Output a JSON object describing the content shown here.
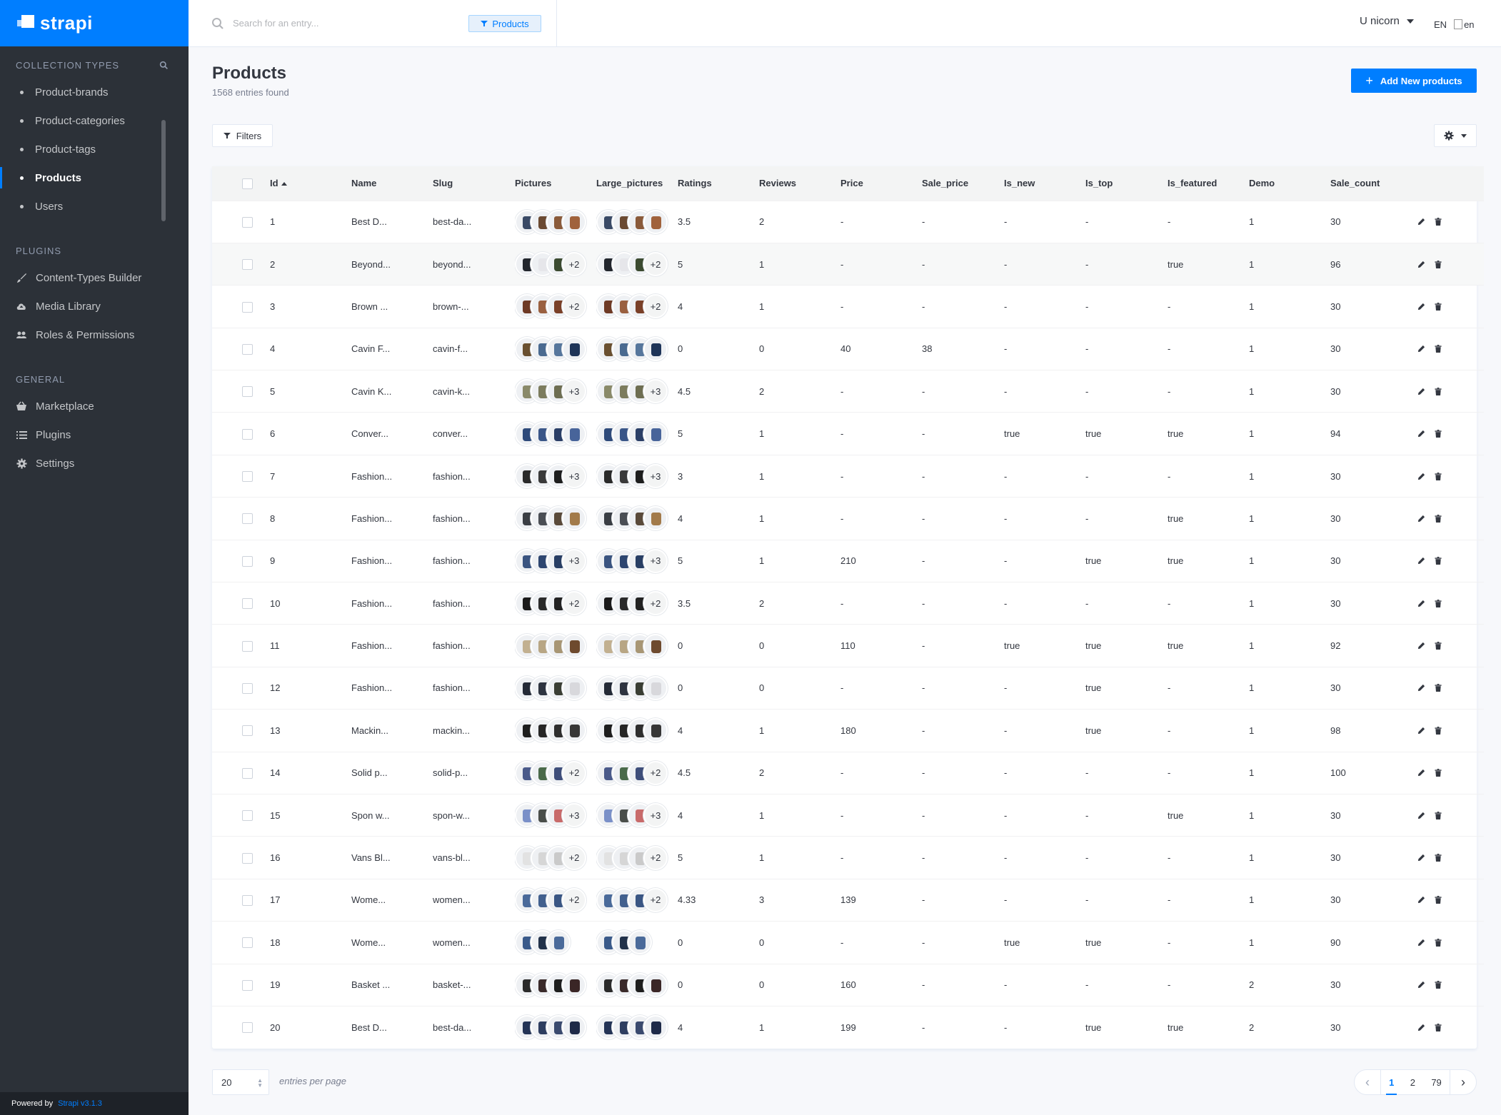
{
  "brand": {
    "name": "strapi"
  },
  "sidebar": {
    "collection_title": "COLLECTION TYPES",
    "collection_items": [
      {
        "label": "Product-brands"
      },
      {
        "label": "Product-categories"
      },
      {
        "label": "Product-tags"
      },
      {
        "label": "Products",
        "active": true
      },
      {
        "label": "Users"
      }
    ],
    "plugins_title": "PLUGINS",
    "plugin_items": [
      {
        "label": "Content-Types Builder",
        "icon": "paint-brush-icon"
      },
      {
        "label": "Media Library",
        "icon": "cloud-upload-icon"
      },
      {
        "label": "Roles & Permissions",
        "icon": "users-icon"
      }
    ],
    "general_title": "GENERAL",
    "general_items": [
      {
        "label": "Marketplace",
        "icon": "shopping-basket-icon"
      },
      {
        "label": "Plugins",
        "icon": "list-icon"
      },
      {
        "label": "Settings",
        "icon": "gear-icon"
      }
    ],
    "powered_by": "Powered by",
    "powered_link": "Strapi v3.1.3"
  },
  "header": {
    "search_placeholder": "Search for an entry...",
    "search_tag": "Products",
    "user": "U nicorn",
    "lang": "EN",
    "flag_alt": "en"
  },
  "page": {
    "title": "Products",
    "subtitle": "1568 entries found",
    "add_button": "Add New products",
    "filters_button": "Filters"
  },
  "table": {
    "columns": [
      "Id",
      "Name",
      "Slug",
      "Pictures",
      "Large_pictures",
      "Ratings",
      "Reviews",
      "Price",
      "Sale_price",
      "Is_new",
      "Is_top",
      "Is_featured",
      "Demo",
      "Sale_count"
    ],
    "rows": [
      {
        "id": "1",
        "name": "Best D...",
        "slug": "best-da...",
        "pics": [
          "#3a4a66",
          "#6b4a32",
          "#8a5a3a",
          "#a0623c"
        ],
        "more": "",
        "ratings": "3.5",
        "reviews": "2",
        "price": "-",
        "sale_price": "-",
        "is_new": "-",
        "is_top": "-",
        "is_featured": "-",
        "demo": "1",
        "sale_count": "30"
      },
      {
        "id": "2",
        "name": "Beyond...",
        "slug": "beyond...",
        "pics": [
          "#22262d",
          "#e6e6ea",
          "#3b4a30"
        ],
        "more": "+2",
        "ratings": "5",
        "reviews": "1",
        "price": "-",
        "sale_price": "-",
        "is_new": "-",
        "is_top": "-",
        "is_featured": "true",
        "demo": "1",
        "sale_count": "96"
      },
      {
        "id": "3",
        "name": "Brown ...",
        "slug": "brown-...",
        "pics": [
          "#6e3a25",
          "#9a6040",
          "#7a4028"
        ],
        "more": "+2",
        "ratings": "4",
        "reviews": "1",
        "price": "-",
        "sale_price": "-",
        "is_new": "-",
        "is_top": "-",
        "is_featured": "-",
        "demo": "1",
        "sale_count": "30"
      },
      {
        "id": "4",
        "name": "Cavin F...",
        "slug": "cavin-f...",
        "pics": [
          "#6a5030",
          "#4a6a90",
          "#56769c",
          "#1e3458"
        ],
        "more": "",
        "ratings": "0",
        "reviews": "0",
        "price": "40",
        "sale_price": "38",
        "is_new": "-",
        "is_top": "-",
        "is_featured": "-",
        "demo": "1",
        "sale_count": "30"
      },
      {
        "id": "5",
        "name": "Cavin K...",
        "slug": "cavin-k...",
        "pics": [
          "#8a8a6a",
          "#7c7c5e",
          "#6e6e52"
        ],
        "more": "+3",
        "ratings": "4.5",
        "reviews": "2",
        "price": "-",
        "sale_price": "-",
        "is_new": "-",
        "is_top": "-",
        "is_featured": "-",
        "demo": "1",
        "sale_count": "30"
      },
      {
        "id": "6",
        "name": "Conver...",
        "slug": "conver...",
        "pics": [
          "#2e4a7a",
          "#3a5688",
          "#2a3e66",
          "#48649a"
        ],
        "more": "",
        "ratings": "5",
        "reviews": "1",
        "price": "-",
        "sale_price": "-",
        "is_new": "true",
        "is_top": "true",
        "is_featured": "true",
        "demo": "1",
        "sale_count": "94"
      },
      {
        "id": "7",
        "name": "Fashion...",
        "slug": "fashion...",
        "pics": [
          "#2a2a2a",
          "#3a3a3a",
          "#1e1e1e"
        ],
        "more": "+3",
        "ratings": "3",
        "reviews": "1",
        "price": "-",
        "sale_price": "-",
        "is_new": "-",
        "is_top": "-",
        "is_featured": "-",
        "demo": "1",
        "sale_count": "30"
      },
      {
        "id": "8",
        "name": "Fashion...",
        "slug": "fashion...",
        "pics": [
          "#3a3e44",
          "#4a4e54",
          "#5a4a3a",
          "#a27a4a"
        ],
        "more": "",
        "ratings": "4",
        "reviews": "1",
        "price": "-",
        "sale_price": "-",
        "is_new": "-",
        "is_top": "-",
        "is_featured": "true",
        "demo": "1",
        "sale_count": "30"
      },
      {
        "id": "9",
        "name": "Fashion...",
        "slug": "fashion...",
        "pics": [
          "#3a5480",
          "#2e4670",
          "#283e64"
        ],
        "more": "+3",
        "ratings": "5",
        "reviews": "1",
        "price": "210",
        "sale_price": "-",
        "is_new": "-",
        "is_top": "true",
        "is_featured": "true",
        "demo": "1",
        "sale_count": "30"
      },
      {
        "id": "10",
        "name": "Fashion...",
        "slug": "fashion...",
        "pics": [
          "#1a1a1a",
          "#2a2a2a",
          "#222222"
        ],
        "more": "+2",
        "ratings": "3.5",
        "reviews": "2",
        "price": "-",
        "sale_price": "-",
        "is_new": "-",
        "is_top": "-",
        "is_featured": "-",
        "demo": "1",
        "sale_count": "30"
      },
      {
        "id": "11",
        "name": "Fashion...",
        "slug": "fashion...",
        "pics": [
          "#c2b090",
          "#b8a684",
          "#a89674",
          "#6e4a2e"
        ],
        "more": "",
        "ratings": "0",
        "reviews": "0",
        "price": "110",
        "sale_price": "-",
        "is_new": "true",
        "is_top": "true",
        "is_featured": "true",
        "demo": "1",
        "sale_count": "92"
      },
      {
        "id": "12",
        "name": "Fashion...",
        "slug": "fashion...",
        "pics": [
          "#242a36",
          "#2e3440",
          "#3a3e34",
          "#d8d8dc"
        ],
        "more": "",
        "ratings": "0",
        "reviews": "0",
        "price": "-",
        "sale_price": "-",
        "is_new": "-",
        "is_top": "true",
        "is_featured": "-",
        "demo": "1",
        "sale_count": "30"
      },
      {
        "id": "13",
        "name": "Mackin...",
        "slug": "mackin...",
        "pics": [
          "#1e1e1e",
          "#262626",
          "#2e2e2e",
          "#363636"
        ],
        "more": "",
        "ratings": "4",
        "reviews": "1",
        "price": "180",
        "sale_price": "-",
        "is_new": "-",
        "is_top": "true",
        "is_featured": "-",
        "demo": "1",
        "sale_count": "98"
      },
      {
        "id": "14",
        "name": "Solid p...",
        "slug": "solid-p...",
        "pics": [
          "#4a5a8a",
          "#4a6a4a",
          "#3e4e7a"
        ],
        "more": "+2",
        "ratings": "4.5",
        "reviews": "2",
        "price": "-",
        "sale_price": "-",
        "is_new": "-",
        "is_top": "-",
        "is_featured": "-",
        "demo": "1",
        "sale_count": "100"
      },
      {
        "id": "15",
        "name": "Spon w...",
        "slug": "spon-w...",
        "pics": [
          "#7a90c8",
          "#4a4e4a",
          "#c86a6a"
        ],
        "more": "+3",
        "ratings": "4",
        "reviews": "1",
        "price": "-",
        "sale_price": "-",
        "is_new": "-",
        "is_top": "-",
        "is_featured": "true",
        "demo": "1",
        "sale_count": "30"
      },
      {
        "id": "16",
        "name": "Vans Bl...",
        "slug": "vans-bl...",
        "pics": [
          "#e2e2e2",
          "#d6d6d6",
          "#cacaca"
        ],
        "more": "+2",
        "ratings": "5",
        "reviews": "1",
        "price": "-",
        "sale_price": "-",
        "is_new": "-",
        "is_top": "-",
        "is_featured": "-",
        "demo": "1",
        "sale_count": "30"
      },
      {
        "id": "17",
        "name": "Wome...",
        "slug": "women...",
        "pics": [
          "#4a6a9a",
          "#42608e",
          "#3a5684"
        ],
        "more": "+2",
        "ratings": "4.33",
        "reviews": "3",
        "price": "139",
        "sale_price": "-",
        "is_new": "-",
        "is_top": "-",
        "is_featured": "-",
        "demo": "1",
        "sale_count": "30"
      },
      {
        "id": "18",
        "name": "Wome...",
        "slug": "women...",
        "pics": [
          "#3a5a8a",
          "#22324a",
          "#4a6a9a"
        ],
        "more": "",
        "ratings": "0",
        "reviews": "0",
        "price": "-",
        "sale_price": "-",
        "is_new": "true",
        "is_top": "true",
        "is_featured": "-",
        "demo": "1",
        "sale_count": "90"
      },
      {
        "id": "19",
        "name": "Basket ...",
        "slug": "basket-...",
        "pics": [
          "#2a2a2a",
          "#3a2a2a",
          "#1e1e1e",
          "#3a2626"
        ],
        "more": "",
        "ratings": "0",
        "reviews": "0",
        "price": "160",
        "sale_price": "-",
        "is_new": "-",
        "is_top": "-",
        "is_featured": "-",
        "demo": "2",
        "sale_count": "30"
      },
      {
        "id": "20",
        "name": "Best D...",
        "slug": "best-da...",
        "pics": [
          "#243456",
          "#2e3e60",
          "#3a4a6e",
          "#1e2a48"
        ],
        "more": "",
        "ratings": "4",
        "reviews": "1",
        "price": "199",
        "sale_price": "-",
        "is_new": "-",
        "is_top": "true",
        "is_featured": "true",
        "demo": "2",
        "sale_count": "30"
      }
    ]
  },
  "pagination": {
    "page_size": "20",
    "per_page_label": "entries per page",
    "pages": [
      "1",
      "2",
      "79"
    ],
    "current": "1"
  }
}
